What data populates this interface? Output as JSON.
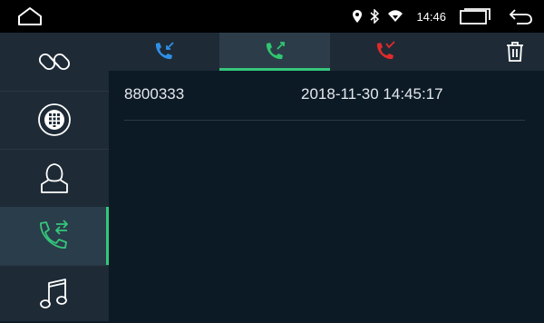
{
  "status_bar": {
    "time": "14:46",
    "icons": [
      "home-icon",
      "location-icon",
      "bluetooth-icon",
      "wifi-icon",
      "recent-apps-icon",
      "back-icon"
    ]
  },
  "sidebar": {
    "items": [
      {
        "name": "link-icon",
        "active": false
      },
      {
        "name": "dialpad-icon",
        "active": false
      },
      {
        "name": "contacts-icon",
        "active": false
      },
      {
        "name": "call-log-icon",
        "active": true
      },
      {
        "name": "music-icon",
        "active": false
      }
    ]
  },
  "tabs": [
    {
      "name": "incoming-calls",
      "icon": "incoming-call-icon",
      "color": "#2f8fe6",
      "active": false
    },
    {
      "name": "outgoing-calls",
      "icon": "outgoing-call-icon",
      "color": "#2fc76f",
      "active": true
    },
    {
      "name": "missed-calls",
      "icon": "missed-call-icon",
      "color": "#e02a2a",
      "active": false
    }
  ],
  "toolbar": {
    "delete_icon": "trash-icon"
  },
  "calls": [
    {
      "number": "8800333",
      "time": "2018-11-30 14:45:17"
    }
  ],
  "colors": {
    "accent": "#34c77b",
    "background": "#0c1a26",
    "panel": "#1e2b36"
  }
}
